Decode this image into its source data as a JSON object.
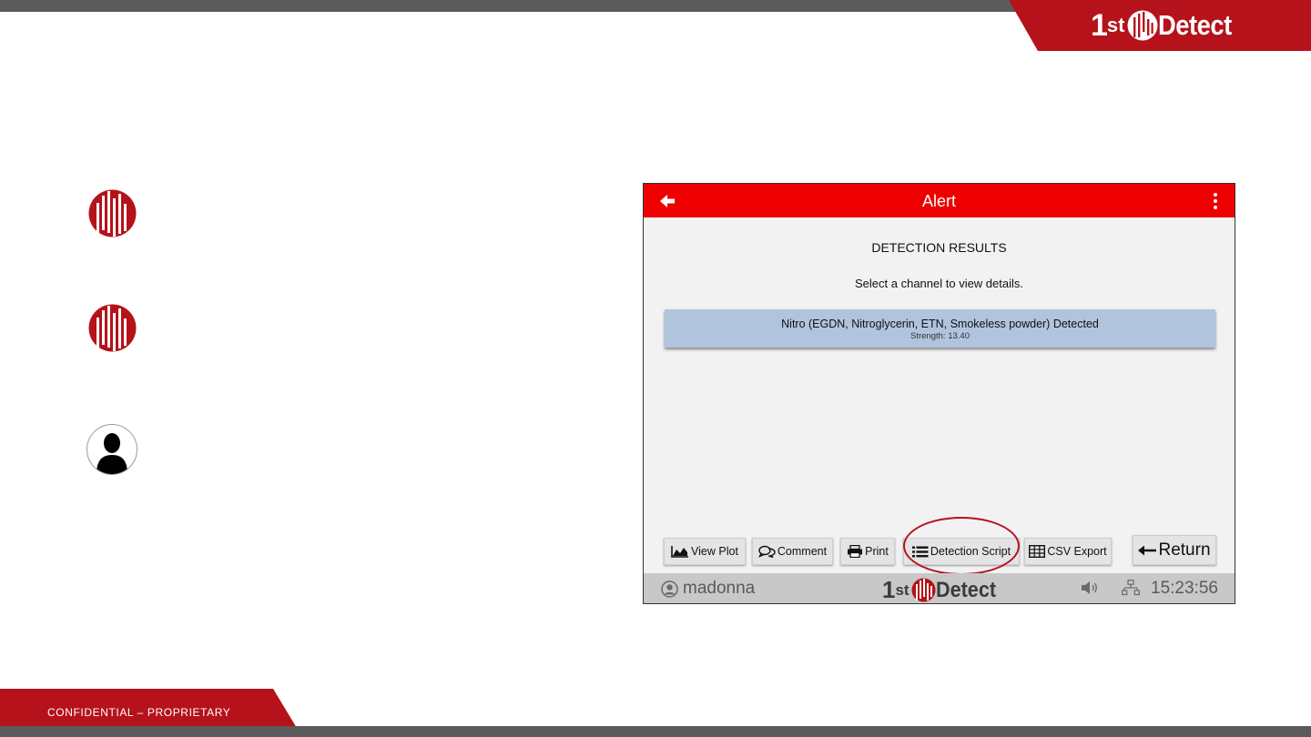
{
  "slide": {
    "brand": {
      "one": "1",
      "st": "st",
      "word": "Detect"
    },
    "footer": "CONFIDENTIAL – PROPRIETARY"
  },
  "bullets": [
    {
      "icon": "company-logo-icon"
    },
    {
      "icon": "company-logo-icon"
    },
    {
      "icon": "user-silhouette-icon"
    }
  ],
  "device": {
    "header": {
      "title": "Alert"
    },
    "heading": "DETECTION RESULTS",
    "instruction": "Select a channel to view details.",
    "result": {
      "name": "Nitro (EGDN, Nitroglycerin, ETN, Smokeless powder)  Detected",
      "strength": "Strength: 13.40"
    },
    "buttons": {
      "view_plot": "View Plot",
      "comment": "Comment",
      "print": "Print",
      "detection_script": "Detection Script",
      "csv_export": "CSV Export",
      "return": "Return"
    },
    "status": {
      "user": "madonna",
      "time": "15:23:56",
      "logo": {
        "one": "1",
        "st": "st",
        "word": "Detect"
      }
    }
  },
  "colors": {
    "brand_red": "#b5121b",
    "header_red": "#ee0000",
    "result_row": "#b0c4de",
    "dark_bar": "#5b5b5b"
  }
}
